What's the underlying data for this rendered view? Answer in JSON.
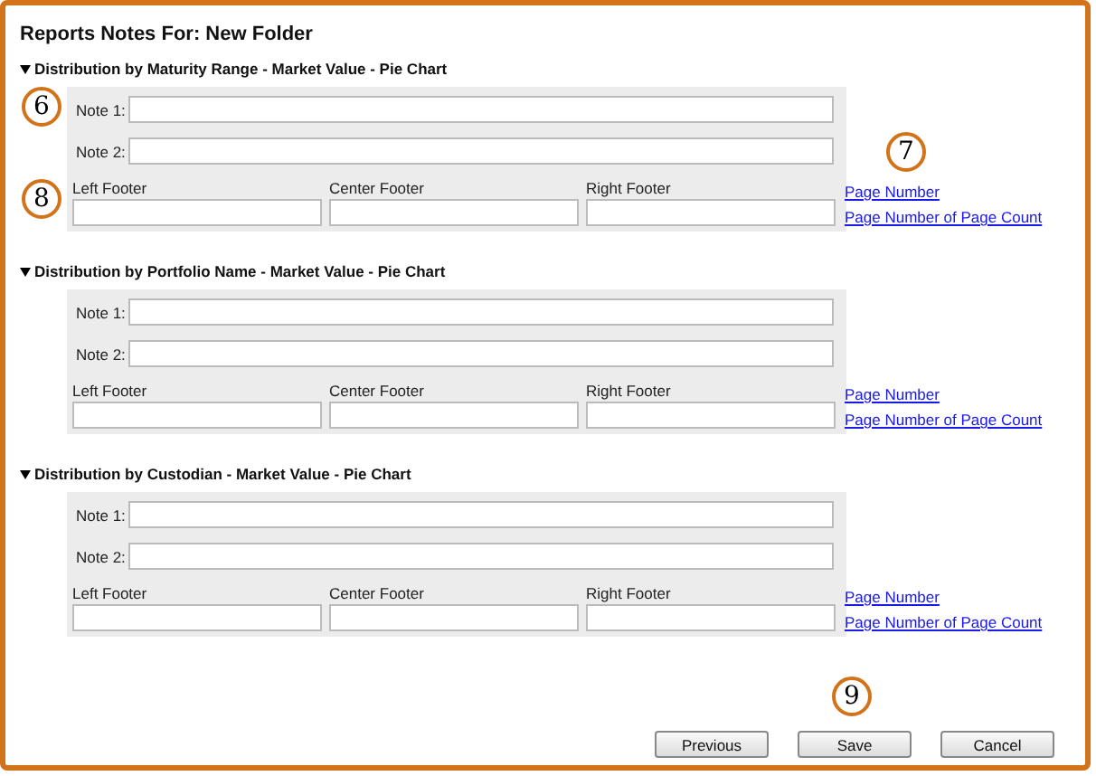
{
  "title": "Reports Notes For: New Folder",
  "sections": [
    {
      "heading": "Distribution by Maturity Range - Market Value - Pie Chart",
      "expanded": true,
      "notes": [
        "Note 1:",
        "Note 2:"
      ],
      "footers": [
        "Left Footer",
        "Center Footer",
        "Right Footer"
      ],
      "links": [
        "Page Number",
        "Page Number of Page Count"
      ],
      "callouts": [
        {
          "text": "6",
          "kind": "notes"
        },
        {
          "text": "7",
          "kind": "links"
        },
        {
          "text": "8",
          "kind": "footers"
        }
      ]
    },
    {
      "heading": "Distribution by Portfolio Name - Market Value - Pie Chart",
      "expanded": true,
      "notes": [
        "Note 1:",
        "Note 2:"
      ],
      "footers": [
        "Left Footer",
        "Center Footer",
        "Right Footer"
      ],
      "links": [
        "Page Number",
        "Page Number of Page Count"
      ]
    },
    {
      "heading": "Distribution by Custodian - Market Value - Pie Chart",
      "expanded": true,
      "notes": [
        "Note 1:",
        "Note 2:"
      ],
      "footers": [
        "Left Footer",
        "Center Footer",
        "Right Footer"
      ],
      "links": [
        "Page Number",
        "Page Number of Page Count"
      ]
    }
  ],
  "buttons_callout": "9",
  "buttons": [
    "Previous",
    "Save",
    "Cancel"
  ]
}
